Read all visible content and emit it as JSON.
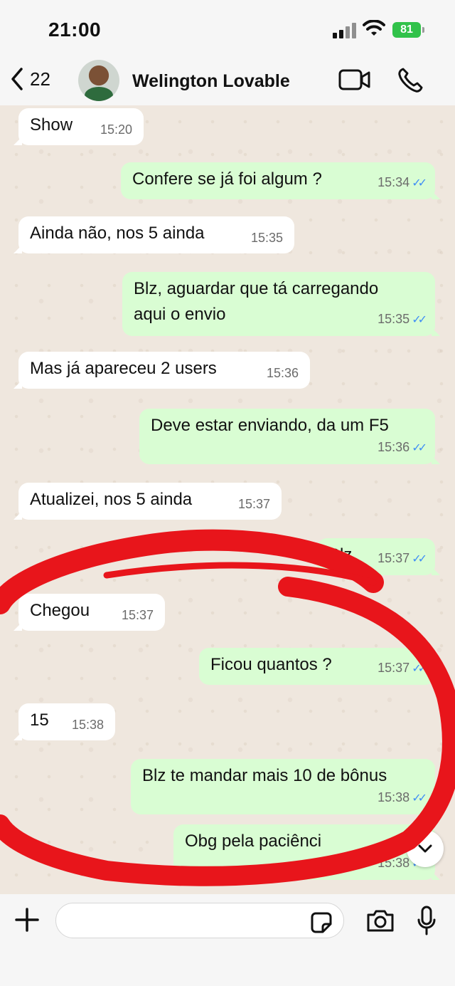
{
  "status_bar": {
    "time": "21:00",
    "battery": "81"
  },
  "header": {
    "back_count": "22",
    "contact_name": "Welington Lovable"
  },
  "messages": [
    {
      "dir": "in",
      "text": "Show",
      "time": "15:20"
    },
    {
      "dir": "out",
      "text": "Confere se já foi algum ?",
      "time": "15:34"
    },
    {
      "dir": "in",
      "text": "Ainda não, nos 5 ainda",
      "time": "15:35"
    },
    {
      "dir": "out",
      "text": "Blz, aguardar que tá carregando",
      "text2": "aqui o envio",
      "time": "15:35"
    },
    {
      "dir": "in",
      "text": "Mas já apareceu 2 users",
      "time": "15:36"
    },
    {
      "dir": "out",
      "text": "Deve estar enviando, da um F5",
      "time": "15:36"
    },
    {
      "dir": "in",
      "text": "Atualizei, nos 5 ainda",
      "time": "15:37"
    },
    {
      "dir": "out",
      "text": "Blz",
      "time": "15:37"
    },
    {
      "dir": "in",
      "text": "Chegou",
      "time": "15:37"
    },
    {
      "dir": "out",
      "text": "Ficou quantos ?",
      "time": "15:37"
    },
    {
      "dir": "in",
      "text": "15",
      "time": "15:38"
    },
    {
      "dir": "out",
      "text": "Blz te mandar mais 10 de bônus",
      "time": "15:38"
    },
    {
      "dir": "out",
      "text": "Obg pela paciênci",
      "time": "15:38"
    }
  ],
  "input": {
    "placeholder": ""
  },
  "colors": {
    "incoming_bubble": "#ffffff",
    "outgoing_bubble": "#d9fdd3",
    "read_ticks": "#3f8ef5",
    "annotation_stroke": "#e8151b"
  },
  "icons": [
    "chevron-left-icon",
    "video-camera-icon",
    "phone-icon",
    "plus-icon",
    "sticker-icon",
    "camera-icon",
    "microphone-icon",
    "chevron-down-icon"
  ]
}
